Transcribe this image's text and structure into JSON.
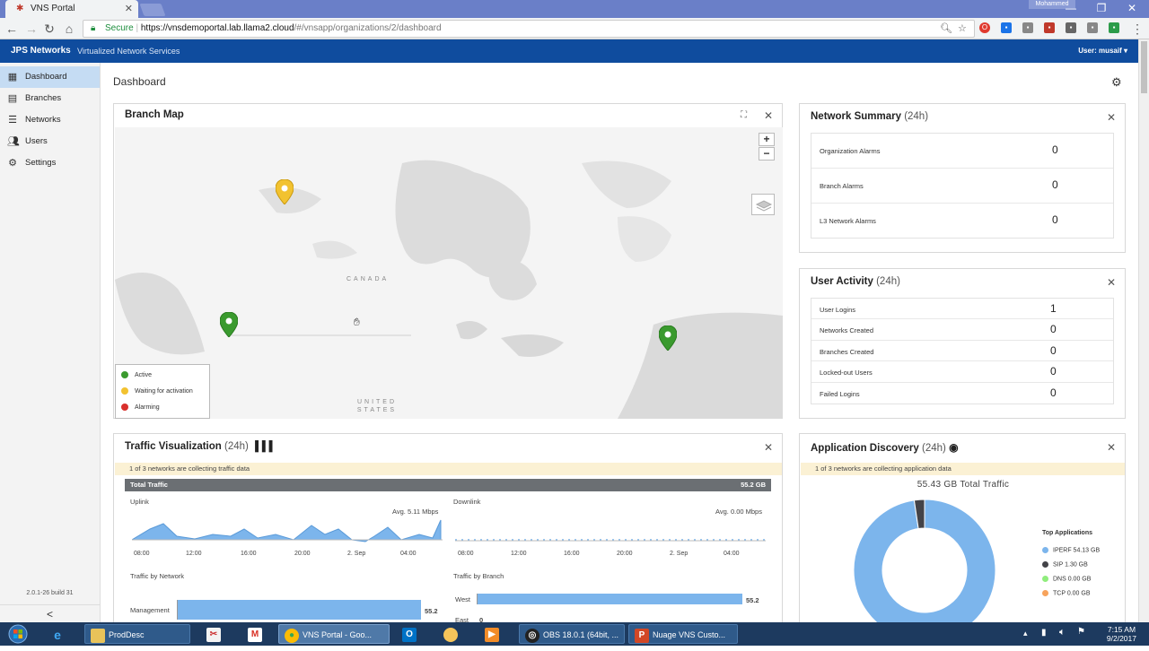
{
  "browser": {
    "tab_title": "VNS Portal",
    "user_chip": "Mohammed",
    "secure_label": "Secure",
    "url_host": "https://vnsdemoportal.lab.llama2.cloud",
    "url_path": "/#/vnsapp/organizations/2/dashboard"
  },
  "header": {
    "brand": "JPS Networks",
    "subtitle": "Virtualized Network Services",
    "user": "User: musaif"
  },
  "sidebar": {
    "items": [
      {
        "label": "Dashboard",
        "icon": "dashboard-icon",
        "active": true
      },
      {
        "label": "Branches",
        "icon": "building-icon"
      },
      {
        "label": "Networks",
        "icon": "network-icon"
      },
      {
        "label": "Users",
        "icon": "users-icon"
      },
      {
        "label": "Settings",
        "icon": "gear-icon"
      }
    ],
    "version": "2.0.1-26 build 31",
    "collapse": "<"
  },
  "page": {
    "title": "Dashboard"
  },
  "branch_map": {
    "title": "Branch Map",
    "labels": {
      "canada": "CANADA",
      "united_states": "UNITED STATES"
    },
    "legend": [
      {
        "label": "Active",
        "color": "#3a9a2e"
      },
      {
        "label": "Waiting for activation",
        "color": "#f2c230"
      },
      {
        "label": "Alarming",
        "color": "#d9302c"
      }
    ],
    "markers": [
      {
        "status": "Waiting for activation",
        "color": "#f2c230"
      },
      {
        "status": "Active",
        "color": "#3a9a2e"
      },
      {
        "status": "Active",
        "color": "#3a9a2e"
      }
    ]
  },
  "network_summary": {
    "title": "Network Summary",
    "period": "(24h)",
    "rows": [
      {
        "label": "Organization Alarms",
        "value": "0"
      },
      {
        "label": "Branch Alarms",
        "value": "0"
      },
      {
        "label": "L3 Network Alarms",
        "value": "0"
      }
    ]
  },
  "user_activity": {
    "title": "User Activity",
    "period": "(24h)",
    "rows": [
      {
        "label": "User Logins",
        "value": "1"
      },
      {
        "label": "Networks Created",
        "value": "0"
      },
      {
        "label": "Branches Created",
        "value": "0"
      },
      {
        "label": "Locked-out Users",
        "value": "0"
      },
      {
        "label": "Failed Logins",
        "value": "0"
      }
    ]
  },
  "traffic": {
    "title": "Traffic Visualization",
    "period": "(24h)",
    "notice": "1 of 3 networks are collecting traffic data",
    "total_label": "Total Traffic",
    "total_value": "55.2 GB",
    "uplink": {
      "label": "Uplink",
      "avg": "Avg. 5.11 Mbps"
    },
    "downlink": {
      "label": "Downlink",
      "avg": "Avg. 0.00 Mbps"
    },
    "time_ticks": [
      "08:00",
      "12:00",
      "16:00",
      "20:00",
      "2. Sep",
      "04:00"
    ],
    "by_network": {
      "label": "Traffic by Network",
      "category": "Management",
      "value": "55.2"
    },
    "by_branch": {
      "label": "Traffic by Branch",
      "categories": [
        "West",
        "East"
      ],
      "values": [
        "55.2",
        "0"
      ]
    }
  },
  "app_discovery": {
    "title": "Application Discovery",
    "period": "(24h)",
    "notice": "1 of 3 networks are collecting application data",
    "total": "55.43 GB Total Traffic",
    "legend_title": "Top Applications",
    "apps": [
      {
        "label": "IPERF 54.13 GB",
        "color": "#7cb5ec",
        "gb": 54.13
      },
      {
        "label": "SIP 1.30 GB",
        "color": "#434348",
        "gb": 1.3
      },
      {
        "label": "DNS 0.00 GB",
        "color": "#90ed7d",
        "gb": 0.0
      },
      {
        "label": "TCP 0.00 GB",
        "color": "#f7a35c",
        "gb": 0.0
      }
    ]
  },
  "taskbar": {
    "items": [
      {
        "label": "ProdDesc",
        "icon": "folder-icon"
      },
      {
        "label": "VNS Portal - Goo...",
        "icon": "chrome-icon"
      },
      {
        "label": "OBS 18.0.1 (64bit, ...",
        "icon": "obs-icon"
      },
      {
        "label": "Nuage VNS Custo...",
        "icon": "powerpoint-icon"
      }
    ],
    "time": "7:15 AM",
    "date": "9/2/2017"
  }
}
